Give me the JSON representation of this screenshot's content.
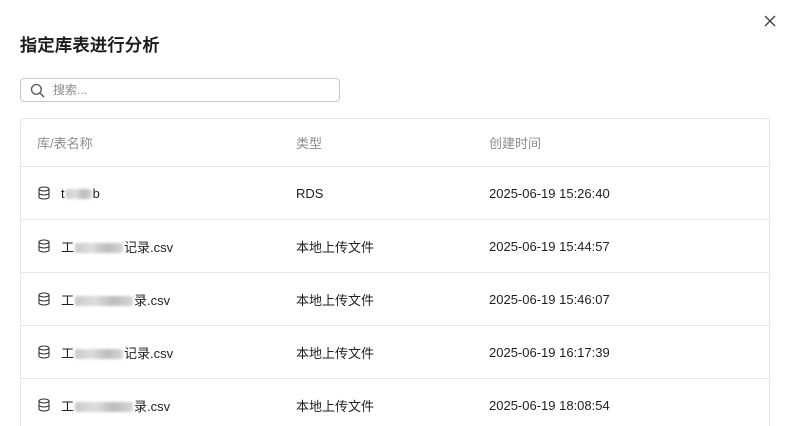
{
  "dialog": {
    "title": "指定库表进行分析",
    "close_icon": "close-icon"
  },
  "search": {
    "placeholder": "搜索..."
  },
  "table": {
    "headers": [
      "库/表名称",
      "类型",
      "创建时间"
    ],
    "rows": [
      {
        "icon": "database-icon",
        "name_prefix": "t",
        "name_suffix": "b",
        "type": "RDS",
        "created": "2025-06-19 15:26:40"
      },
      {
        "icon": "database-icon",
        "name_prefix": "工",
        "name_suffix": "记录.csv",
        "type": "本地上传文件",
        "created": "2025-06-19 15:44:57"
      },
      {
        "icon": "database-icon",
        "name_prefix": "工",
        "name_suffix": "录.csv",
        "type": "本地上传文件",
        "created": "2025-06-19 15:46:07"
      },
      {
        "icon": "database-icon",
        "name_prefix": "工",
        "name_suffix": "记录.csv",
        "type": "本地上传文件",
        "created": "2025-06-19 16:17:39"
      },
      {
        "icon": "database-icon",
        "name_prefix": "工",
        "name_suffix": "录.csv",
        "type": "本地上传文件",
        "created": "2025-06-19 18:08:54"
      }
    ]
  }
}
